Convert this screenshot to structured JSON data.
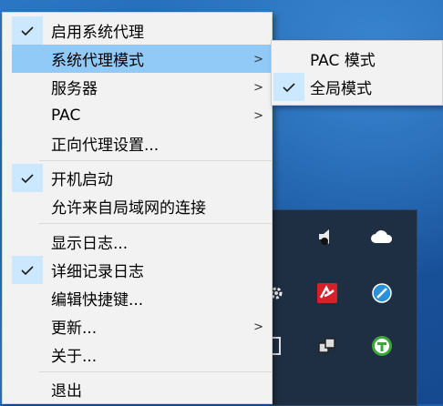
{
  "menu": {
    "items": [
      {
        "label": "启用系统代理",
        "checked": true,
        "submenu": false
      },
      {
        "label": "系统代理模式",
        "checked": false,
        "submenu": true,
        "selected": true
      },
      {
        "label": "服务器",
        "checked": false,
        "submenu": true
      },
      {
        "label": "PAC",
        "checked": false,
        "submenu": true
      },
      {
        "label": "正向代理设置...",
        "checked": false,
        "submenu": false
      },
      {
        "label": "开机启动",
        "checked": true,
        "submenu": false
      },
      {
        "label": "允许来自局域网的连接",
        "checked": false,
        "submenu": false
      },
      {
        "label": "显示日志...",
        "checked": false,
        "submenu": false
      },
      {
        "label": "详细记录日志",
        "checked": true,
        "submenu": false
      },
      {
        "label": "编辑快捷键...",
        "checked": false,
        "submenu": false
      },
      {
        "label": "更新...",
        "checked": false,
        "submenu": true
      },
      {
        "label": "关于...",
        "checked": false,
        "submenu": false
      },
      {
        "label": "退出",
        "checked": false,
        "submenu": false
      }
    ]
  },
  "submenu": {
    "items": [
      {
        "label": "PAC 模式",
        "checked": false
      },
      {
        "label": "全局模式",
        "checked": true
      }
    ]
  },
  "tray": {
    "icons": [
      "speaker-icon",
      "cloud-icon",
      "gear-icon",
      "antivirus-icon",
      "compass-icon",
      "window-icon",
      "copy-icon",
      "torrent-icon"
    ]
  },
  "colors": {
    "highlight": "#91c9f7",
    "check_bg": "#cce8ff",
    "menu_bg": "#f2f2f2",
    "tray_bg": "#1f2f43"
  }
}
